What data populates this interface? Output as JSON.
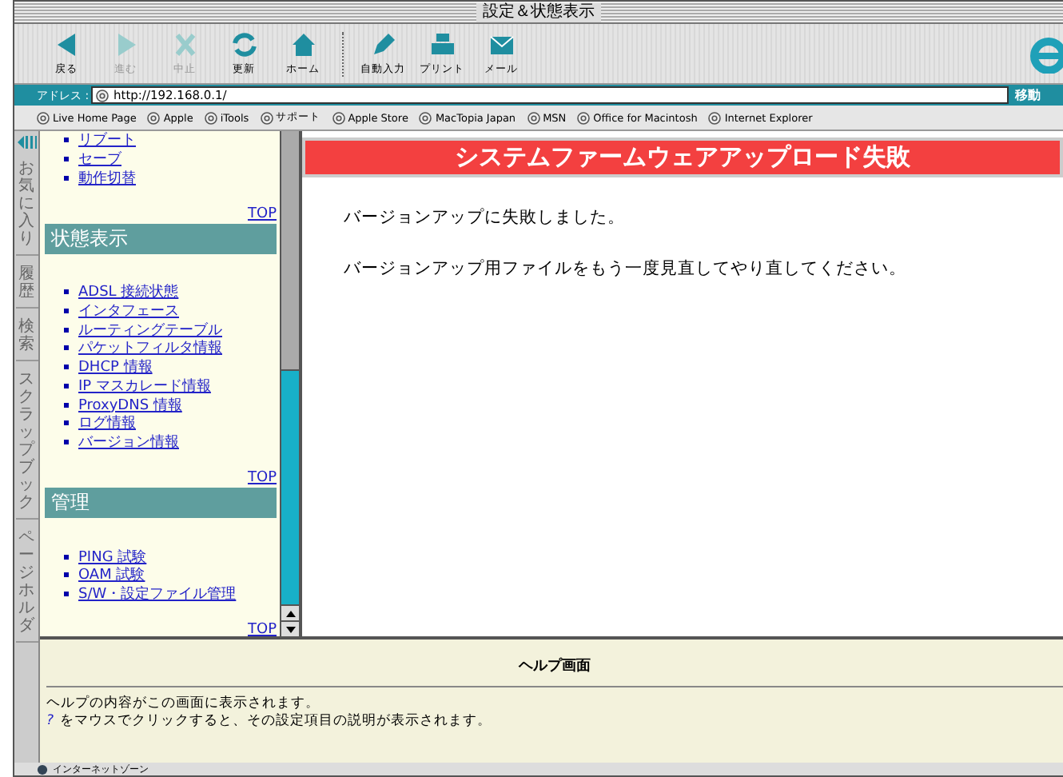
{
  "window": {
    "title": "設定＆状態表示"
  },
  "toolbar": [
    {
      "kind": "back",
      "label": "戻る",
      "disabled": false
    },
    {
      "kind": "forward",
      "label": "進む",
      "disabled": true
    },
    {
      "kind": "stop",
      "label": "中止",
      "disabled": true
    },
    {
      "kind": "refresh",
      "label": "更新",
      "disabled": false
    },
    {
      "kind": "home",
      "label": "ホーム",
      "disabled": false
    },
    {
      "kind": "autofill",
      "label": "自動入力",
      "disabled": false
    },
    {
      "kind": "print",
      "label": "プリント",
      "disabled": false
    },
    {
      "kind": "mail",
      "label": "メール",
      "disabled": false
    }
  ],
  "address": {
    "label": "アドレス :",
    "url": "http://192.168.0.1/",
    "go": "移動"
  },
  "favorites": [
    "Live Home Page",
    "Apple",
    "iTools",
    "サポート",
    "Apple Store",
    "MacTopia Japan",
    "MSN",
    "Office for Macintosh",
    "Internet Explorer"
  ],
  "side_tabs": [
    "お気に入り",
    "履歴",
    "検索",
    "スクラップブック",
    "ページホルダ"
  ],
  "nav": {
    "sections": [
      {
        "links": [
          "リブート",
          "セーブ",
          "動作切替"
        ],
        "top": "TOP"
      },
      {
        "heading": "状態表示",
        "links": [
          "ADSL 接続状態",
          "インタフェース",
          "ルーティングテーブル",
          "パケットフィルタ情報",
          "DHCP 情報",
          "IP マスカレード情報",
          "ProxyDNS 情報",
          "ログ情報",
          "バージョン情報"
        ],
        "top": "TOP"
      },
      {
        "heading": "管理",
        "links": [
          "PING 試験",
          "OAM 試験",
          "S/W・設定ファイル管理"
        ],
        "top": "TOP"
      }
    ]
  },
  "main": {
    "banner": "システムファームウェアアップロード失敗",
    "messages": [
      "バージョンアップに失敗しました。",
      "バージョンアップ用ファイルをもう一度見直してやり直してください。"
    ]
  },
  "help": {
    "title": "ヘルプ画面",
    "lines": [
      {
        "text": "ヘルプの内容がこの画面に表示されます。"
      },
      {
        "mark": "?",
        "text": "をマウスでクリックすると、その設定項目の説明が表示されます。"
      }
    ]
  },
  "status": "インターネットゾーン"
}
